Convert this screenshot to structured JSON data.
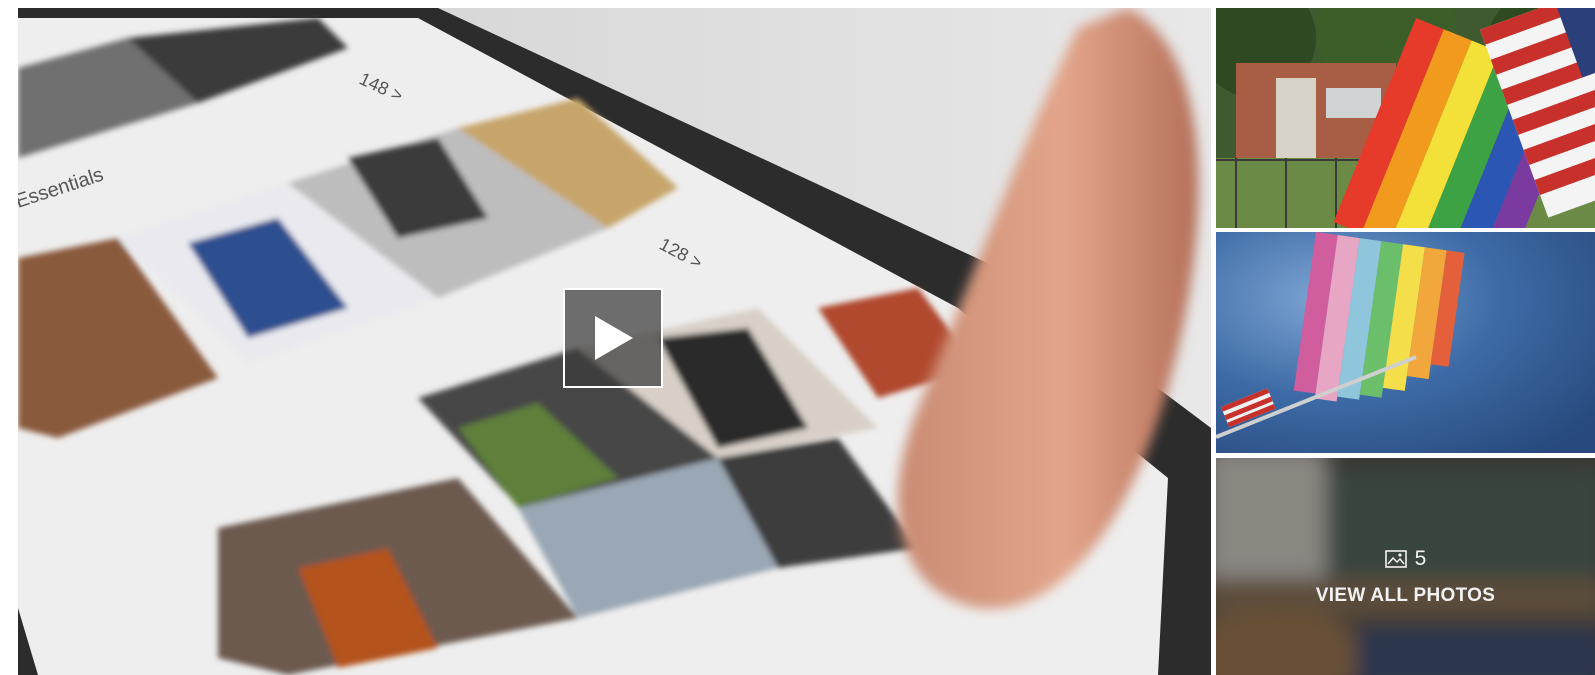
{
  "gallery": {
    "main_video": {
      "play_icon": "play-icon",
      "screen_counts": [
        "148 >",
        "128 >"
      ],
      "screen_label": "Essentials"
    },
    "thumbnails": [
      {
        "subject": "rainbow pride flag and american flag"
      },
      {
        "subject": "rainbow pride flag against blue sky"
      },
      {
        "subject": "blurred classroom"
      }
    ],
    "overlay": {
      "photo_icon": "image-icon",
      "photo_count": "5",
      "view_all_label": "VIEW ALL PHOTOS"
    }
  },
  "colors": {
    "play_overlay": "#3c3c3c",
    "overlay_text": "#f2f2f2"
  }
}
